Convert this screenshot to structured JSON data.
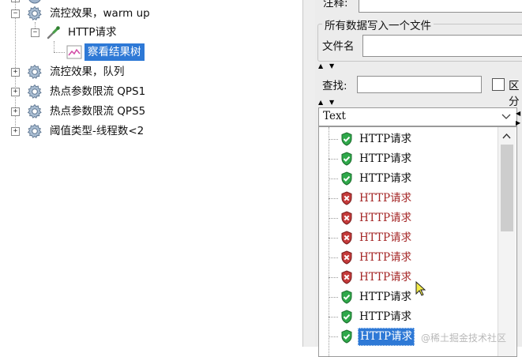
{
  "tree": {
    "items": [
      {
        "label": "流控效果，warm up",
        "expander": "−"
      },
      {
        "label": "HTTP请求",
        "expander": "−"
      },
      {
        "label": "察看结果树"
      },
      {
        "label": "流控效果，队列",
        "expander": "+"
      },
      {
        "label": "热点参数限流 QPS1",
        "expander": "+"
      },
      {
        "label": "热点参数限流 QPS5",
        "expander": "+"
      },
      {
        "label": "阈值类型-线程数<2",
        "expander": "+"
      }
    ]
  },
  "right": {
    "comment_label": "注释:",
    "write_all_label": "所有数据写入一个文件",
    "filename_label": "文件名",
    "filename_value": "",
    "search_label": "查找:",
    "search_value": "",
    "case_label": "区分",
    "renderer_selected": "Text",
    "results": [
      {
        "label": "HTTP请求",
        "status": "success"
      },
      {
        "label": "HTTP请求",
        "status": "success"
      },
      {
        "label": "HTTP请求",
        "status": "success"
      },
      {
        "label": "HTTP请求",
        "status": "error"
      },
      {
        "label": "HTTP请求",
        "status": "error"
      },
      {
        "label": "HTTP请求",
        "status": "error"
      },
      {
        "label": "HTTP请求",
        "status": "error"
      },
      {
        "label": "HTTP请求",
        "status": "error"
      },
      {
        "label": "HTTP请求",
        "status": "success"
      },
      {
        "label": "HTTP请求",
        "status": "success"
      },
      {
        "label": "HTTP请求",
        "status": "success",
        "selected": true
      }
    ]
  },
  "watermark": "@稀土掘金技术社区",
  "colors": {
    "selection": "#2e79d6",
    "error_text": "#a42525",
    "success_shield": "#2fa84a",
    "error_shield": "#c43a3a"
  }
}
